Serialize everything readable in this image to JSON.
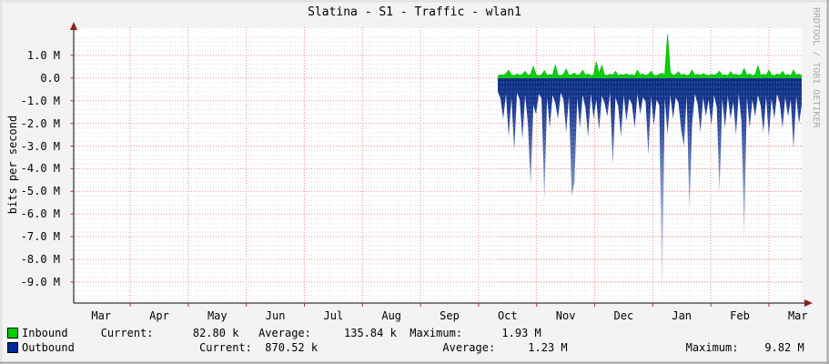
{
  "title": "Slatina - S1 - Traffic - wlan1",
  "watermark": "RRDTOOL / TOBI OETIKER",
  "chart_data": {
    "type": "area",
    "title": "Slatina - S1 - Traffic - wlan1",
    "xlabel": "",
    "ylabel": "bits per second",
    "unit_note": "values in Mbit/s (M = 1e6 bits/s); outbound plotted as negative",
    "ylim_M": [
      -9.95,
      2.24
    ],
    "grid": "on",
    "legend_position": "bottom",
    "x_tick_labels": [
      "Mar",
      "Apr",
      "May",
      "Jun",
      "Jul",
      "Aug",
      "Sep",
      "Oct",
      "Nov",
      "Dec",
      "Jan",
      "Feb",
      "Mar"
    ],
    "y_tick_labels": [
      "1.0 M",
      "0.0",
      "-1.0 M",
      "-2.0 M",
      "-3.0 M",
      "-4.0 M",
      "-5.0 M",
      "-6.0 M",
      "-7.0 M",
      "-8.0 M",
      "-9.0 M"
    ],
    "y_tick_values_M": [
      1,
      0,
      -1,
      -2,
      -3,
      -4,
      -5,
      -6,
      -7,
      -8,
      -9
    ],
    "data_begins_at": "Oct",
    "data_start_frac": 0.5825,
    "series": [
      {
        "name": "Inbound",
        "color": "#00CF00",
        "edge_color": "#00B000",
        "plotted": "positive",
        "values_M": [
          0.1,
          0.15,
          0.12,
          0.2,
          0.35,
          0.14,
          0.11,
          0.18,
          0.13,
          0.16,
          0.3,
          0.12,
          0.17,
          0.52,
          0.15,
          0.11,
          0.14,
          0.33,
          0.12,
          0.16,
          0.13,
          0.58,
          0.14,
          0.11,
          0.17,
          0.4,
          0.13,
          0.15,
          0.22,
          0.12,
          0.16,
          0.35,
          0.13,
          0.18,
          0.11,
          0.15,
          0.72,
          0.2,
          0.55,
          0.14,
          0.12,
          0.17,
          0.13,
          0.3,
          0.11,
          0.16,
          0.13,
          0.19,
          0.12,
          0.15,
          0.11,
          0.35,
          0.14,
          0.18,
          0.12,
          0.16,
          0.3,
          0.13,
          0.11,
          0.17,
          0.22,
          0.14,
          1.93,
          0.25,
          0.13,
          0.16,
          0.28,
          0.12,
          0.18,
          0.11,
          0.15,
          0.35,
          0.13,
          0.17,
          0.12,
          0.2,
          0.14,
          0.11,
          0.16,
          0.13,
          0.18,
          0.3,
          0.12,
          0.15,
          0.11,
          0.28,
          0.14,
          0.17,
          0.12,
          0.16,
          0.42,
          0.13,
          0.19,
          0.11,
          0.15,
          0.55,
          0.13,
          0.17,
          0.12,
          0.35,
          0.14,
          0.11,
          0.18,
          0.13,
          0.3,
          0.12,
          0.16,
          0.11,
          0.35,
          0.14,
          0.17,
          0.12
        ]
      },
      {
        "name": "Outbound",
        "color": "#002A97",
        "gradient_tip_color": "#E8EEF8",
        "plotted": "negative",
        "values_M": [
          0.6,
          0.9,
          1.8,
          0.7,
          2.6,
          0.85,
          3.2,
          0.65,
          0.95,
          2.7,
          0.75,
          2.0,
          4.7,
          1.2,
          1.6,
          0.7,
          0.9,
          5.3,
          0.85,
          2.2,
          0.75,
          1.1,
          1.8,
          0.65,
          0.95,
          2.4,
          0.8,
          5.2,
          4.6,
          0.9,
          2.2,
          0.75,
          1.3,
          2.6,
          0.7,
          1.8,
          0.95,
          2.3,
          0.8,
          1.1,
          1.7,
          0.65,
          3.8,
          0.85,
          1.25,
          2.6,
          0.75,
          1.9,
          0.9,
          1.15,
          2.2,
          0.7,
          1.6,
          0.85,
          1.05,
          3.4,
          0.8,
          2.1,
          0.95,
          1.2,
          9.82,
          0.9,
          2.5,
          0.75,
          1.8,
          0.85,
          1.1,
          2.3,
          3.0,
          0.8,
          5.8,
          2.0,
          0.7,
          1.15,
          2.4,
          0.85,
          1.7,
          0.95,
          2.1,
          0.75,
          1.3,
          5.0,
          0.9,
          2.2,
          0.8,
          1.8,
          1.05,
          2.5,
          0.7,
          1.9,
          6.9,
          0.85,
          2.2,
          0.95,
          1.7,
          0.75,
          1.2,
          2.4,
          0.8,
          2.6,
          0.9,
          1.8,
          0.7,
          1.1,
          2.2,
          0.85,
          1.7,
          0.95,
          3.1,
          0.8,
          2.0,
          1.2
        ]
      }
    ],
    "legend": {
      "inbound": {
        "label": "Inbound",
        "current": "82.80 k",
        "average": "135.84 k",
        "maximum": "1.93 M"
      },
      "outbound": {
        "label": "Outbound",
        "current": "870.52 k",
        "average": "1.23 M",
        "maximum": "9.82 M"
      },
      "row1_text": "Inbound     Current:      82.80 k   Average:     135.84 k  Maximum:      1.93 M",
      "row2_text": "Outbound                   Current:  870.52 k                   Average:     1.23 M                  Maximum:    9.82 M"
    },
    "colors": {
      "background": "#f3f3f3",
      "canvas": "#ffffff",
      "major_grid": "#e98a8a",
      "minor_grid": "#dedede",
      "axis": "#000000",
      "arrow": "#8b1e1e",
      "watermark_text": "#aaaaaa"
    }
  }
}
